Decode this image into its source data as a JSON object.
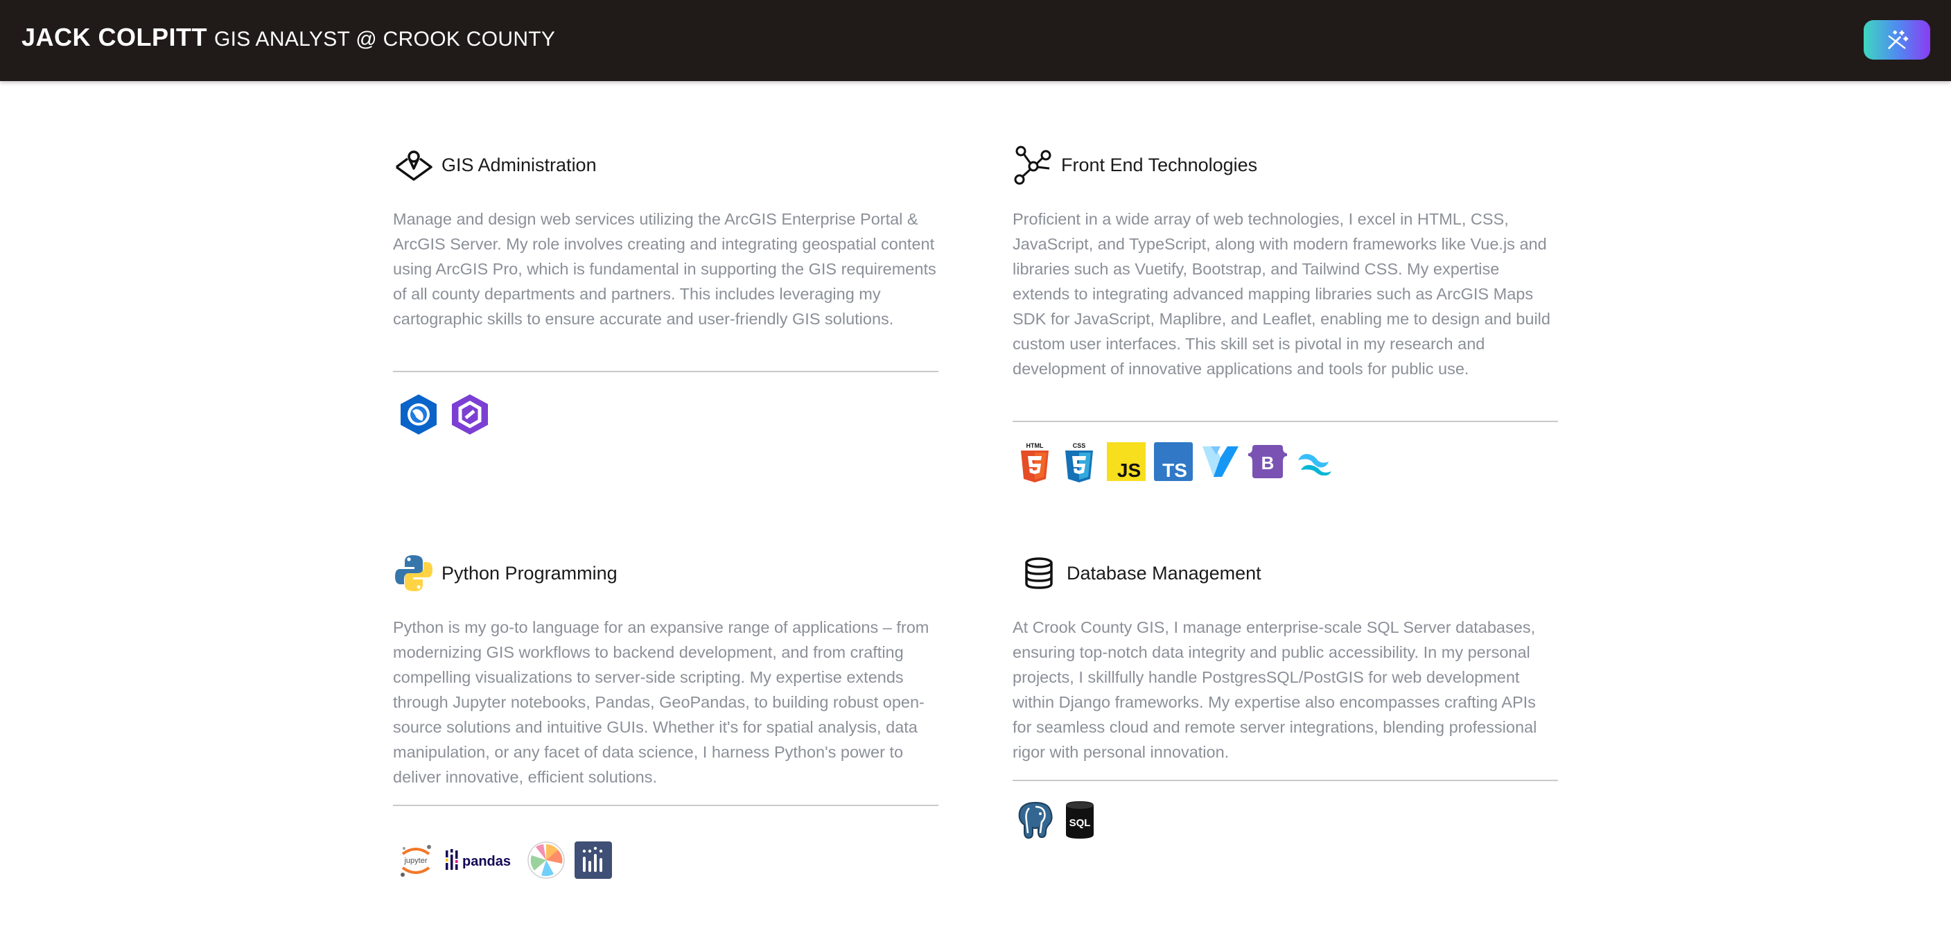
{
  "header": {
    "brand": "JACK COLPITT",
    "subtitle": "GIS ANALYST @ CROOK COUNTY",
    "theme_toggle_icon": "magic-wand-icon"
  },
  "colors": {
    "header_bg": "#201b18",
    "text_muted": "#8b8f97",
    "divider": "#c9c9c9",
    "toggle_gradient": [
      "#3fd6c0",
      "#4f8cf0",
      "#8a3cf2"
    ]
  },
  "cards": [
    {
      "icon": "map-pin-icon",
      "title": "GIS Administration",
      "description": "Manage and design web services utilizing the ArcGIS Enterprise Portal & ArcGIS Server. My role involves creating and integrating geospatial content using ArcGIS Pro, which is fundamental in supporting the GIS requirements of all county departments and partners. This includes leveraging my cartographic skills to ensure accurate and user-friendly GIS solutions.",
      "techs": [
        "arcgis-pro-icon",
        "arcgis-enterprise-icon"
      ]
    },
    {
      "icon": "network-nodes-icon",
      "title": "Front End Technologies",
      "description": "Proficient in a wide array of web technologies, I excel in HTML, CSS, JavaScript, and TypeScript, along with modern frameworks like Vue.js and libraries such as Vuetify, Bootstrap, and Tailwind CSS. My expertise extends to integrating advanced mapping libraries such as ArcGIS Maps SDK for JavaScript, Maplibre, and Leaflet, enabling me to design and build custom user interfaces. This skill set is pivotal in my research and development of innovative applications and tools for public use.",
      "techs": [
        "html5-icon",
        "css3-icon",
        "javascript-icon",
        "typescript-icon",
        "vuetify-icon",
        "bootstrap-icon",
        "tailwind-icon"
      ]
    },
    {
      "icon": "python-icon",
      "title": "Python Programming",
      "description": "Python is my go-to language for an expansive range of applications – from modernizing GIS workflows to backend development, and from crafting compelling visualizations to server-side scripting. My expertise extends through Jupyter notebooks, Pandas, GeoPandas, to building robust open-source solutions and intuitive GUIs. Whether it's for spatial analysis, data manipulation, or any facet of data science, I harness Python's power to deliver innovative, efficient solutions.",
      "techs": [
        "jupyter-icon",
        "pandas-icon",
        "matplotlib-icon",
        "plotly-icon"
      ]
    },
    {
      "icon": "database-icon",
      "title": "Database Management",
      "description": "At Crook County GIS, I manage enterprise-scale SQL Server databases, ensuring top-notch data integrity and public accessibility. In my personal projects, I skillfully handle PostgresSQL/PostGIS for web development within Django frameworks. My expertise also encompasses crafting APIs for seamless cloud and remote server integrations, blending professional rigor with personal innovation.",
      "techs": [
        "postgresql-icon",
        "sql-server-icon"
      ]
    }
  ],
  "logo_text": {
    "html": "HTML",
    "css": "CSS",
    "js": "JS",
    "ts": "TS",
    "bootstrap": "B",
    "jupyter": "jupyter",
    "pandas": "pandas",
    "sql": "SQL"
  }
}
